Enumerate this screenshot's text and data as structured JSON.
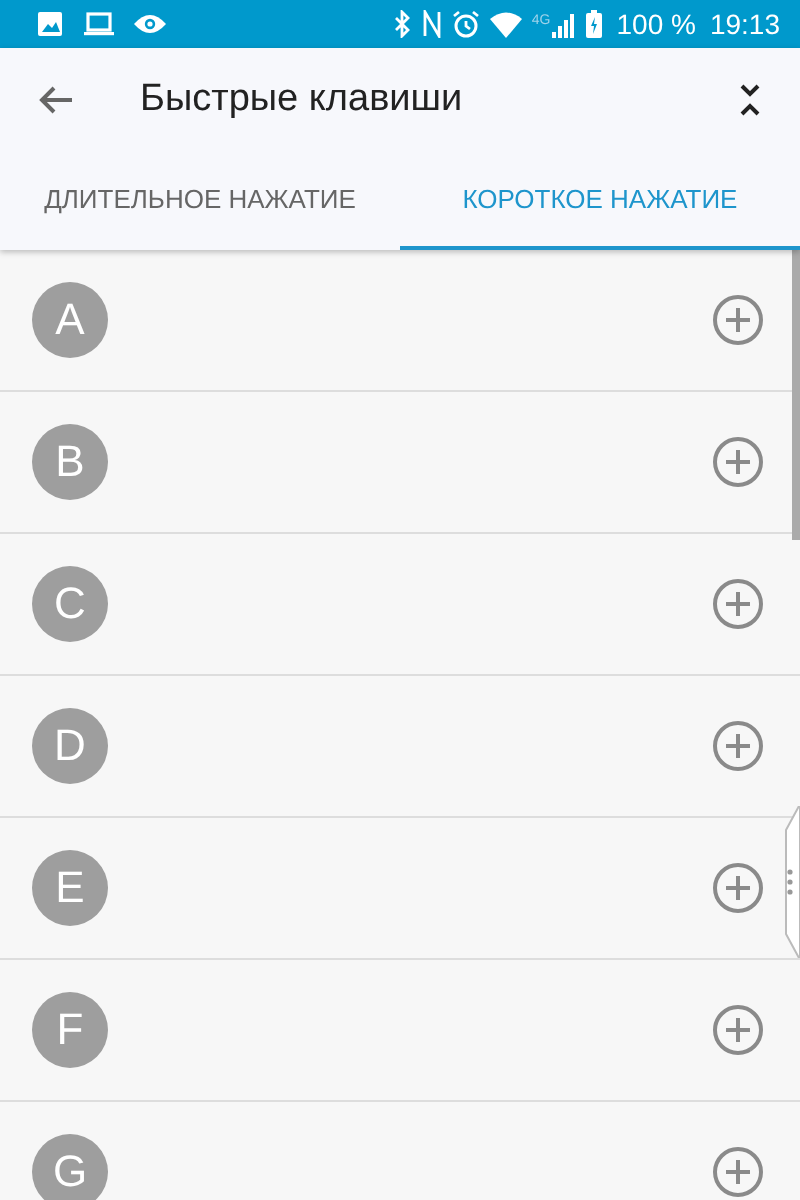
{
  "status_bar": {
    "network": "4G",
    "battery": "100 %",
    "time": "19:13"
  },
  "toolbar": {
    "title": "Быстрые клавиши"
  },
  "tabs": [
    {
      "label": "ДЛИТЕЛЬНОЕ НАЖАТИЕ",
      "selected": false
    },
    {
      "label": "КОРОТКОЕ НАЖАТИЕ",
      "selected": true
    }
  ],
  "keys": [
    {
      "letter": "A"
    },
    {
      "letter": "B"
    },
    {
      "letter": "C"
    },
    {
      "letter": "D"
    },
    {
      "letter": "E"
    },
    {
      "letter": "F"
    },
    {
      "letter": "G"
    }
  ]
}
